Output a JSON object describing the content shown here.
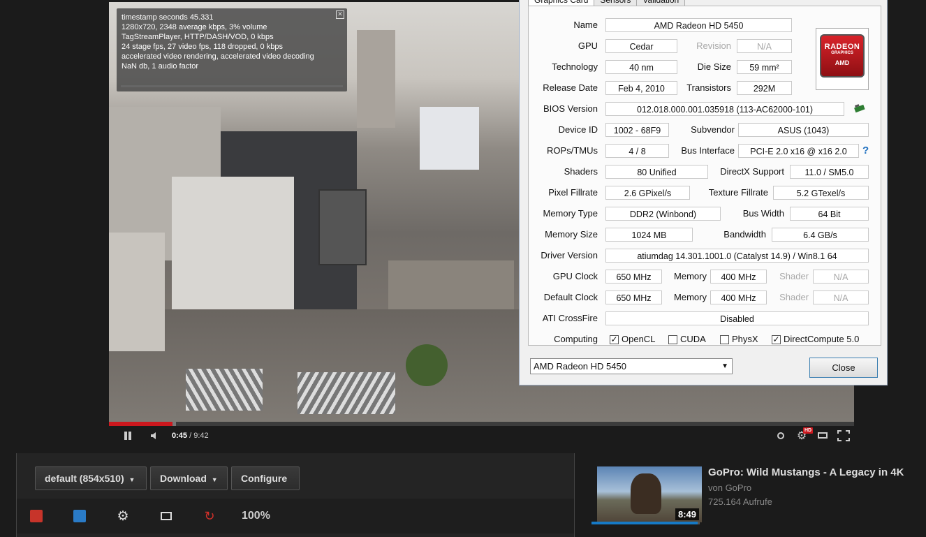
{
  "stats": {
    "lines": [
      "timestamp seconds 45.331",
      "1280x720, 2348 average kbps, 3% volume",
      "TagStreamPlayer, HTTP/DASH/VOD, 0 kbps",
      "24 stage fps, 27 video fps, 118 dropped, 0 kbps",
      "accelerated video rendering, accelerated video decoding",
      "NaN db, 1 audio factor"
    ]
  },
  "player": {
    "time_current": "0:45",
    "time_sep": " / ",
    "time_total": "9:42",
    "progress": 0.085,
    "buffered": 0.09,
    "hd_badge": "HD"
  },
  "gpuz": {
    "tabs": [
      "Graphics Card",
      "Sensors",
      "Validation"
    ],
    "name_label": "Name",
    "name": "AMD Radeon HD 5450",
    "gpu_label": "GPU",
    "gpu": "Cedar",
    "revision_label": "Revision",
    "revision": "N/A",
    "tech_label": "Technology",
    "tech": "40 nm",
    "diesize_label": "Die Size",
    "diesize": "59 mm²",
    "release_label": "Release Date",
    "release": "Feb 4, 2010",
    "transistors_label": "Transistors",
    "transistors": "292M",
    "bios_label": "BIOS Version",
    "bios": "012.018.000.001.035918 (113-AC62000-101)",
    "deviceid_label": "Device ID",
    "deviceid": "1002 - 68F9",
    "subvendor_label": "Subvendor",
    "subvendor": "ASUS (1043)",
    "rops_label": "ROPs/TMUs",
    "rops": "4 / 8",
    "bus_label": "Bus Interface",
    "bus": "PCI-E 2.0 x16 @ x16 2.0",
    "shaders_label": "Shaders",
    "shaders": "80 Unified",
    "directx_label": "DirectX Support",
    "directx": "11.0 / SM5.0",
    "pixel_label": "Pixel Fillrate",
    "pixel": "2.6 GPixel/s",
    "texture_label": "Texture Fillrate",
    "texture": "5.2 GTexel/s",
    "memtype_label": "Memory Type",
    "memtype": "DDR2 (Winbond)",
    "buswidth_label": "Bus Width",
    "buswidth": "64 Bit",
    "memsize_label": "Memory Size",
    "memsize": "1024 MB",
    "bandwidth_label": "Bandwidth",
    "bandwidth": "6.4 GB/s",
    "driver_label": "Driver Version",
    "driver": "atiumdag 14.301.1001.0 (Catalyst 14.9) / Win8.1 64",
    "gpuclock_label": "GPU Clock",
    "gpuclock": "650 MHz",
    "memory_label": "Memory",
    "memclock": "400 MHz",
    "shader_label": "Shader",
    "shaderclock": "N/A",
    "defclock_label": "Default Clock",
    "defclock": "650 MHz",
    "defmem": "400 MHz",
    "defshader": "N/A",
    "crossfire_label": "ATI CrossFire",
    "crossfire": "Disabled",
    "computing_label": "Computing",
    "computing": [
      {
        "label": "OpenCL",
        "checked": true
      },
      {
        "label": "CUDA",
        "checked": false
      },
      {
        "label": "PhysX",
        "checked": false
      },
      {
        "label": "DirectCompute 5.0",
        "checked": true
      }
    ],
    "logo_top": "RADEON",
    "logo_mid": "GRAPHICS",
    "logo_bottom": "AMD",
    "selected_card": "AMD Radeon HD 5450",
    "close_label": "Close",
    "help_glyph": "?"
  },
  "plugin": {
    "quality": "default (854x510)",
    "download": "Download",
    "configure": "Configure",
    "zoom": "100%"
  },
  "related": {
    "title": "GoPro: Wild Mustangs - A Legacy in 4K",
    "channel": "von GoPro",
    "views": "725.164 Aufrufe",
    "duration": "8:49",
    "watched": 0.98
  },
  "colors": {
    "accent_red": "#cc181e",
    "amd_red": "#d8232a",
    "dialog_bg": "#f0f0f0"
  }
}
